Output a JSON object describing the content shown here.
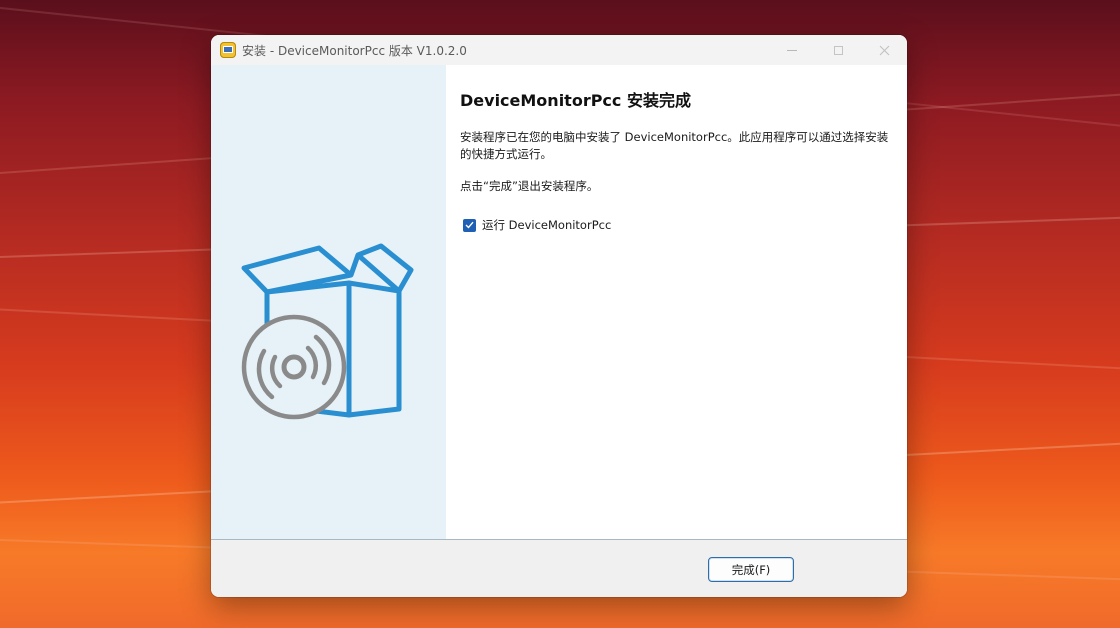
{
  "window": {
    "title": "安装 - DeviceMonitorPcc 版本 V1.0.2.0",
    "app_icon": "installer-app-icon",
    "controls": {
      "minimize_icon": "minimize-icon",
      "maximize_icon": "maximize-icon",
      "close_icon": "close-icon"
    }
  },
  "wizard": {
    "heading": "DeviceMonitorPcc 安装完成",
    "description": "安装程序已在您的电脑中安装了 DeviceMonitorPcc。此应用程序可以通过选择安装的快捷方式运行。",
    "instruction": "点击“完成”退出安装程序。",
    "run_checkbox": {
      "label": "运行 DeviceMonitorPcc",
      "checked": true
    },
    "side_image": "box-with-disc-icon"
  },
  "footer": {
    "finish_label": "完成(F)"
  },
  "colors": {
    "side_panel": "#e7f2f8",
    "accent": "#1f5fb4",
    "box_blue": "#2a8fd0",
    "disc_gray": "#8a8a8a"
  }
}
